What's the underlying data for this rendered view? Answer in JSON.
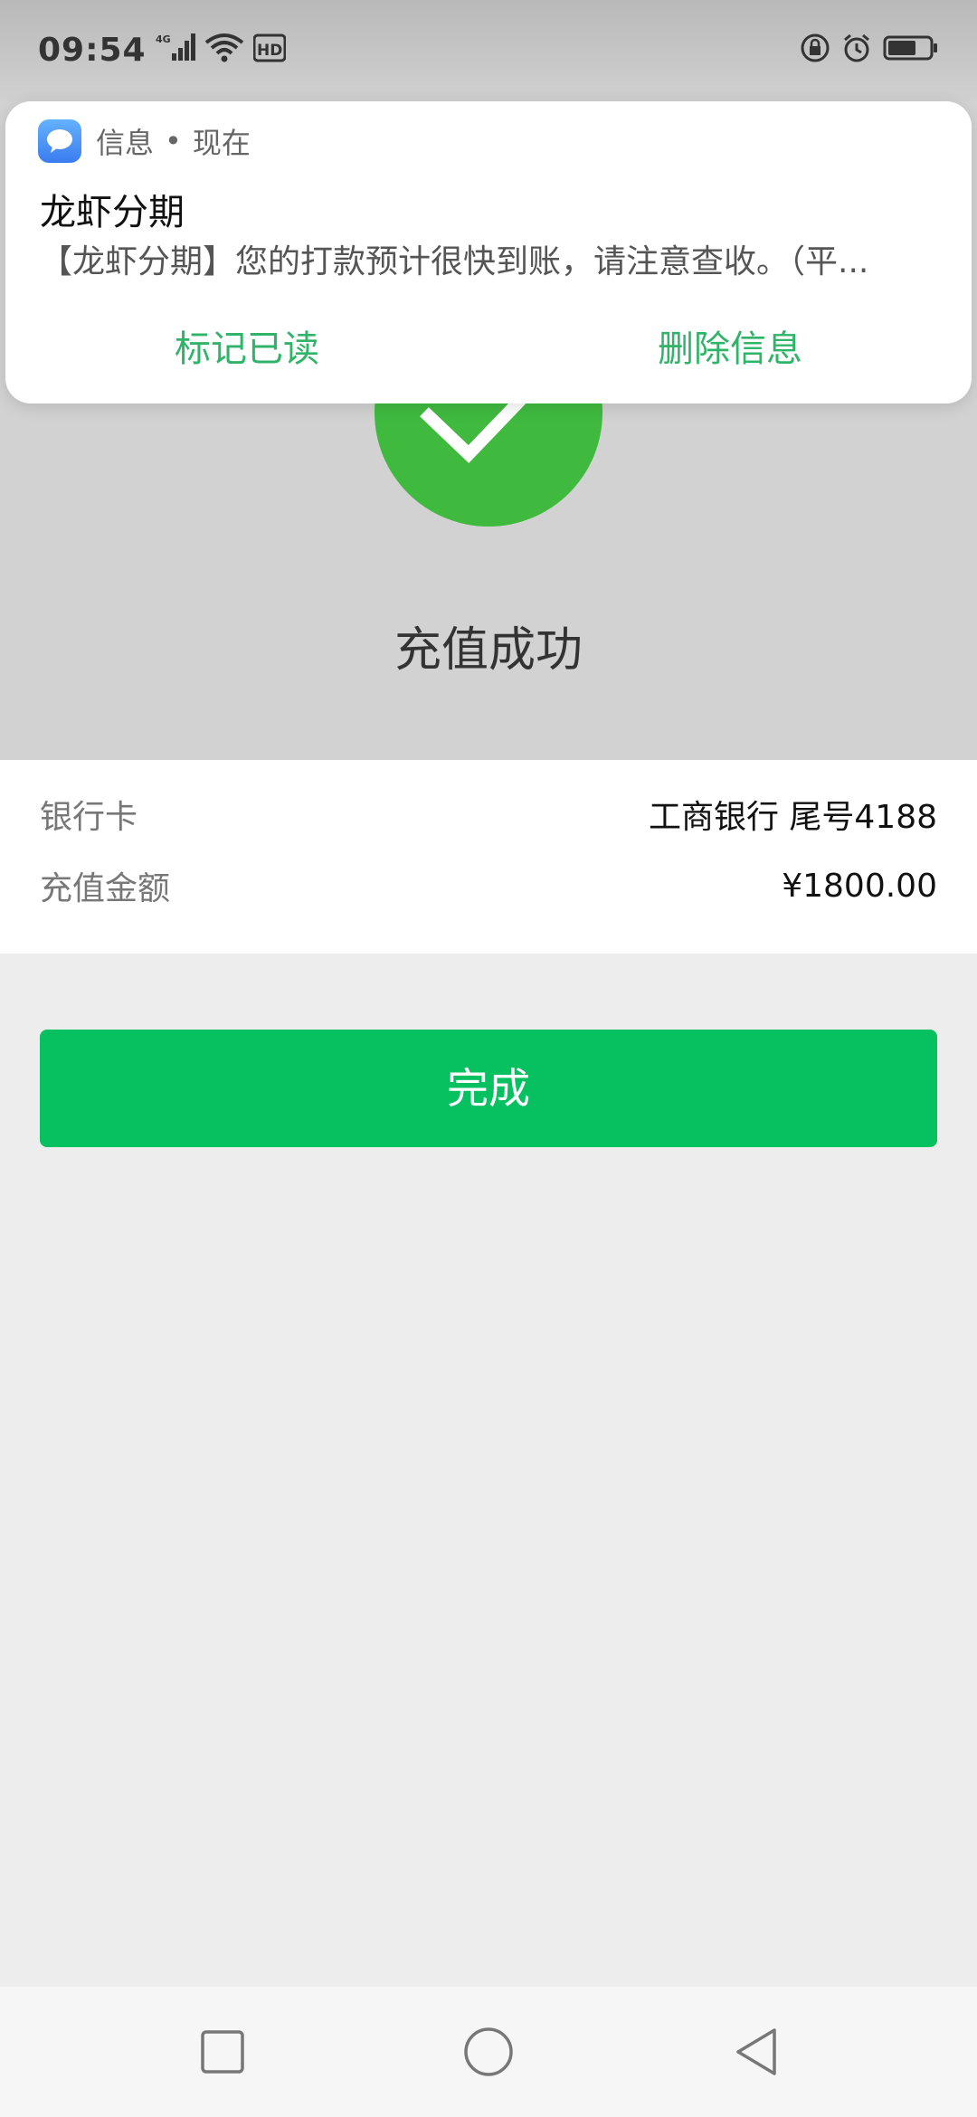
{
  "status_bar": {
    "time": "09:54",
    "network_label": "4G",
    "hd_label": "HD"
  },
  "notification": {
    "app_name": "信息",
    "separator": "•",
    "time": "现在",
    "title": "龙虾分期",
    "body": "【龙虾分期】您的打款预计很快到账，请注意查收。（平...",
    "actions": [
      "标记已读",
      "删除信息"
    ]
  },
  "result": {
    "title": "充值成功"
  },
  "details": {
    "rows": [
      {
        "label": "银行卡",
        "value": "工商银行 尾号4188"
      },
      {
        "label": "充值金额",
        "value": "¥1800.00"
      }
    ]
  },
  "done_button": "完成",
  "colors": {
    "primary_green": "#07c160",
    "success_green": "#3fba3f",
    "action_green": "#31b46a"
  },
  "icons": {
    "navbar": [
      "recent-apps-square-icon",
      "home-circle-icon",
      "back-triangle-icon"
    ],
    "status": [
      "signal-icon",
      "wifi-icon",
      "lock-icon",
      "alarm-icon",
      "battery-icon"
    ]
  }
}
